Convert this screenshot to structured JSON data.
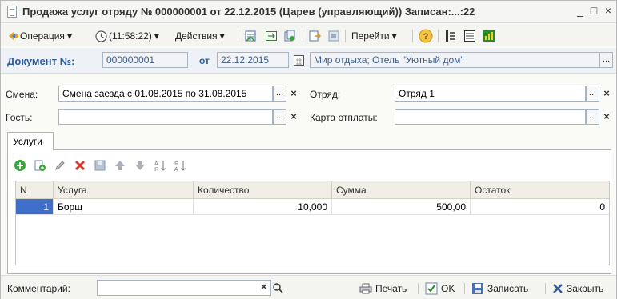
{
  "window": {
    "title": "Продажа услуг отряду № 000000001 от 22.12.2015 (Царев (управляющий)) Записан:...:22",
    "minimize": "_",
    "maximize": "□",
    "close": "×"
  },
  "toolbar": {
    "operation": "Операция",
    "time": "(11:58:22)",
    "actions": "Действия",
    "goto": "Перейти",
    "dropdown_arrow": "▾"
  },
  "doc": {
    "number_label": "Документ №:",
    "number_value": "000000001",
    "date_label": "от",
    "date_value": "22.12.2015",
    "organization": "Мир отдыха; Отель \"Уютный дом\""
  },
  "form": {
    "shift_label": "Смена:",
    "shift_value": "Смена заезда с 01.08.2015 по 31.08.2015",
    "detachment_label": "Отряд:",
    "detachment_value": "Отряд 1",
    "guest_label": "Гость:",
    "guest_value": "",
    "card_label": "Карта отплаты:",
    "card_value": "",
    "select_btn": "...",
    "clear_btn": "×"
  },
  "tabs": [
    {
      "label": "Услуги"
    }
  ],
  "grid": {
    "columns": [
      "N",
      "Услуга",
      "Количество",
      "Сумма",
      "Остаток"
    ],
    "rows": [
      {
        "n": "1",
        "service": "Борщ",
        "qty": "10,000",
        "sum": "500,00",
        "rest": "0"
      }
    ]
  },
  "footer": {
    "comment_label": "Комментарий:",
    "comment_value": "",
    "print": "Печать",
    "ok": "OK",
    "save": "Записать",
    "close": "Закрыть"
  },
  "colors": {
    "accent_blue": "#2f5c9a",
    "selection": "#3f6fcb",
    "add_green": "#3aa53a",
    "delete_red": "#d63a2b"
  }
}
